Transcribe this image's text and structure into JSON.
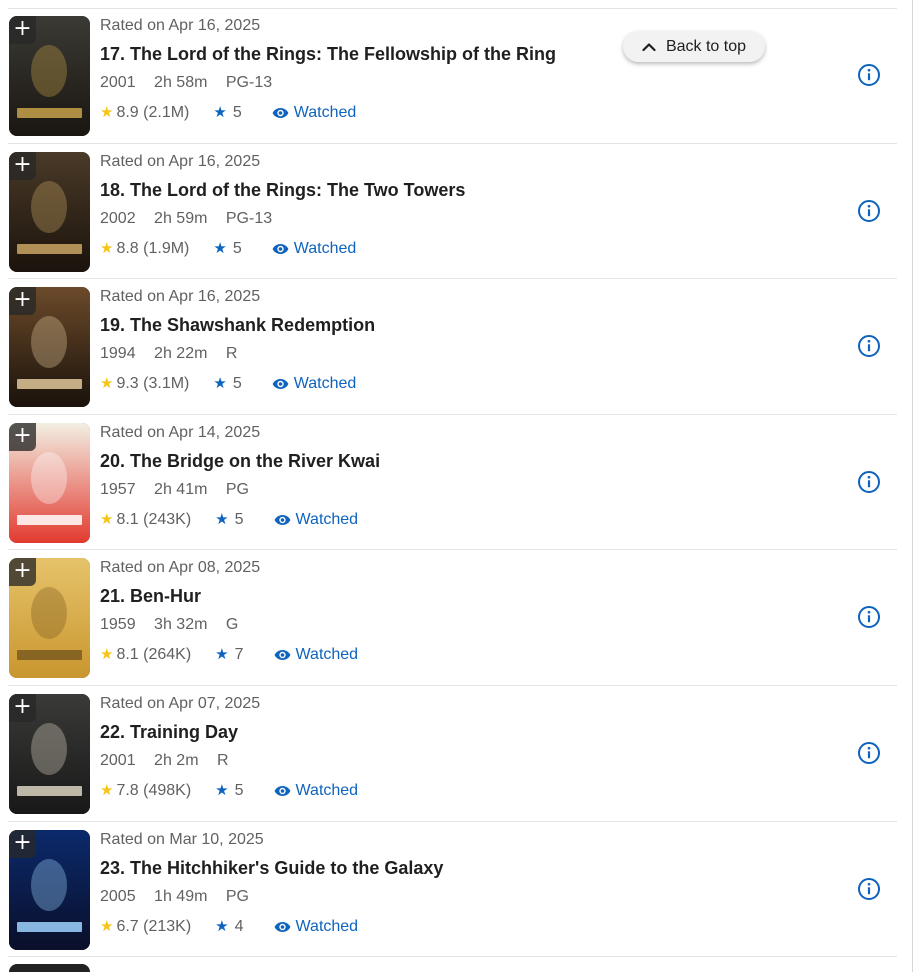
{
  "back_to_top": {
    "label": "Back to top"
  },
  "items": [
    {
      "rated_on": "Rated on Apr 16, 2025",
      "title": "17. The Lord of the Rings: The Fellowship of the Ring",
      "year": "2001",
      "runtime": "2h 58m",
      "certificate": "PG-13",
      "imdb_rating": "8.9 (2.1M)",
      "user_rating": "5",
      "watched_label": "Watched",
      "poster": {
        "top": "#3b3a34",
        "bottom": "#1a1611",
        "accent": "#c8a24a",
        "logo": "LORD RINGS"
      }
    },
    {
      "rated_on": "Rated on Apr 16, 2025",
      "title": "18. The Lord of the Rings: The Two Towers",
      "year": "2002",
      "runtime": "2h 59m",
      "certificate": "PG-13",
      "imdb_rating": "8.8 (1.9M)",
      "user_rating": "5",
      "watched_label": "Watched",
      "poster": {
        "top": "#4a3a28",
        "bottom": "#1b130c",
        "accent": "#c9a663",
        "logo": "LORD RINGS"
      }
    },
    {
      "rated_on": "Rated on Apr 16, 2025",
      "title": "19. The Shawshank Redemption",
      "year": "1994",
      "runtime": "2h 22m",
      "certificate": "R",
      "imdb_rating": "9.3 (3.1M)",
      "user_rating": "5",
      "watched_label": "Watched",
      "poster": {
        "top": "#6b4a2a",
        "bottom": "#1a120b",
        "accent": "#e0c89a",
        "logo": "SHAWSHANK"
      }
    },
    {
      "rated_on": "Rated on Apr 14, 2025",
      "title": "20. The Bridge on the River Kwai",
      "year": "1957",
      "runtime": "2h 41m",
      "certificate": "PG",
      "imdb_rating": "8.1 (243K)",
      "user_rating": "5",
      "watched_label": "Watched",
      "poster": {
        "top": "#f3efe3",
        "bottom": "#e23a2f",
        "accent": "#ffffff",
        "logo": "RIVER KWAI"
      }
    },
    {
      "rated_on": "Rated on Apr 08, 2025",
      "title": "21. Ben-Hur",
      "year": "1959",
      "runtime": "3h 32m",
      "certificate": "G",
      "imdb_rating": "8.1 (264K)",
      "user_rating": "7",
      "watched_label": "Watched",
      "poster": {
        "top": "#e6c36a",
        "bottom": "#c9962f",
        "accent": "#7a5a1e",
        "logo": "BEN HUR"
      }
    },
    {
      "rated_on": "Rated on Apr 07, 2025",
      "title": "22. Training Day",
      "year": "2001",
      "runtime": "2h 2m",
      "certificate": "R",
      "imdb_rating": "7.8 (498K)",
      "user_rating": "5",
      "watched_label": "Watched",
      "poster": {
        "top": "#3a3a38",
        "bottom": "#181818",
        "accent": "#d9d3c1",
        "logo": "TRAINING DAY"
      }
    },
    {
      "rated_on": "Rated on Mar 10, 2025",
      "title": "23. The Hitchhiker's Guide to the Galaxy",
      "year": "2005",
      "runtime": "1h 49m",
      "certificate": "PG",
      "imdb_rating": "6.7 (213K)",
      "user_rating": "4",
      "watched_label": "Watched",
      "poster": {
        "top": "#0b2a6b",
        "bottom": "#0a0f2a",
        "accent": "#9fd3ff",
        "logo": "HITCHHIKERS"
      }
    }
  ],
  "icons": {
    "add": "plus-icon",
    "imdb_star": "star-icon",
    "user_star": "star-icon",
    "watched": "eye-icon",
    "info": "info-icon",
    "back_to_top": "chevron-up-icon"
  },
  "colors": {
    "accent_blue": "#0e63be",
    "imdb_gold": "#f5c518",
    "text_primary": "#1f1f1f",
    "text_secondary": "#616161"
  }
}
